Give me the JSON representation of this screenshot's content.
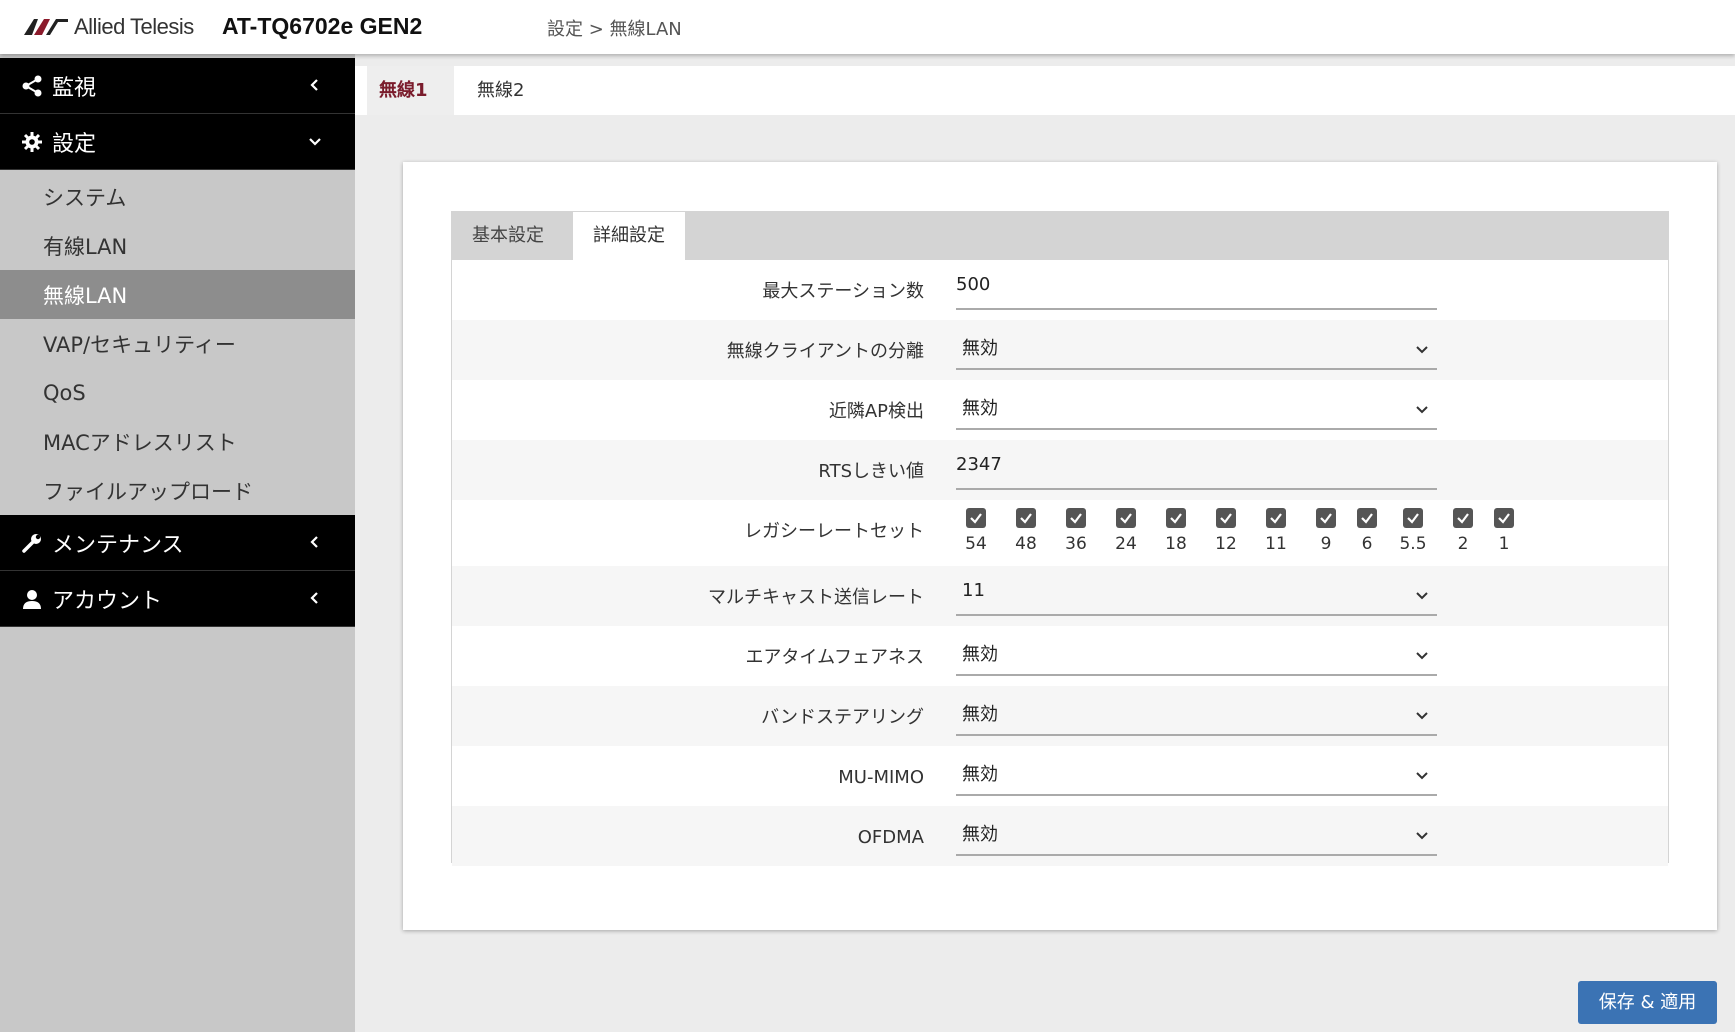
{
  "header": {
    "logo_text": "Allied Telesis",
    "model": "AT-TQ6702e GEN2",
    "breadcrumb": "設定 > 無線LAN"
  },
  "sidebar": {
    "monitor": "監視",
    "settings": "設定",
    "settings_items": [
      "システム",
      "有線LAN",
      "無線LAN",
      "VAP/セキュリティー",
      "QoS",
      "MACアドレスリスト",
      "ファイルアップロード"
    ],
    "active_item": "無線LAN",
    "maintenance": "メンテナンス",
    "account": "アカウント"
  },
  "radio_tabs": [
    "無線1",
    "無線2"
  ],
  "active_radio_tab": "無線1",
  "sub_tabs": [
    "基本設定",
    "詳細設定"
  ],
  "active_sub_tab": "詳細設定",
  "form": {
    "max_stations": {
      "label": "最大ステーション数",
      "value": "500"
    },
    "client_isolation": {
      "label": "無線クライアントの分離",
      "value": "無効"
    },
    "neighbor_ap": {
      "label": "近隣AP検出",
      "value": "無効"
    },
    "rts_threshold": {
      "label": "RTSしきい値",
      "value": "2347"
    },
    "legacy_rates": {
      "label": "レガシーレートセット",
      "rates": [
        "54",
        "48",
        "36",
        "24",
        "18",
        "12",
        "11",
        "9",
        "6",
        "5.5",
        "2",
        "1"
      ],
      "checked": [
        true,
        true,
        true,
        true,
        true,
        true,
        true,
        true,
        true,
        true,
        true,
        true
      ]
    },
    "multicast_rate": {
      "label": "マルチキャスト送信レート",
      "value": "11"
    },
    "airtime_fairness": {
      "label": "エアタイムフェアネス",
      "value": "無効"
    },
    "band_steering": {
      "label": "バンドステアリング",
      "value": "無効"
    },
    "mu_mimo": {
      "label": "MU-MIMO",
      "value": "無効"
    },
    "ofdma": {
      "label": "OFDMA",
      "value": "無効"
    }
  },
  "save_button": "保存 & 適用",
  "colors": {
    "accent": "#3b73b4",
    "active_tab_text": "#7a1c2c",
    "sidebar_bg": "#c8c8c8",
    "nav_header_bg": "#000000"
  }
}
